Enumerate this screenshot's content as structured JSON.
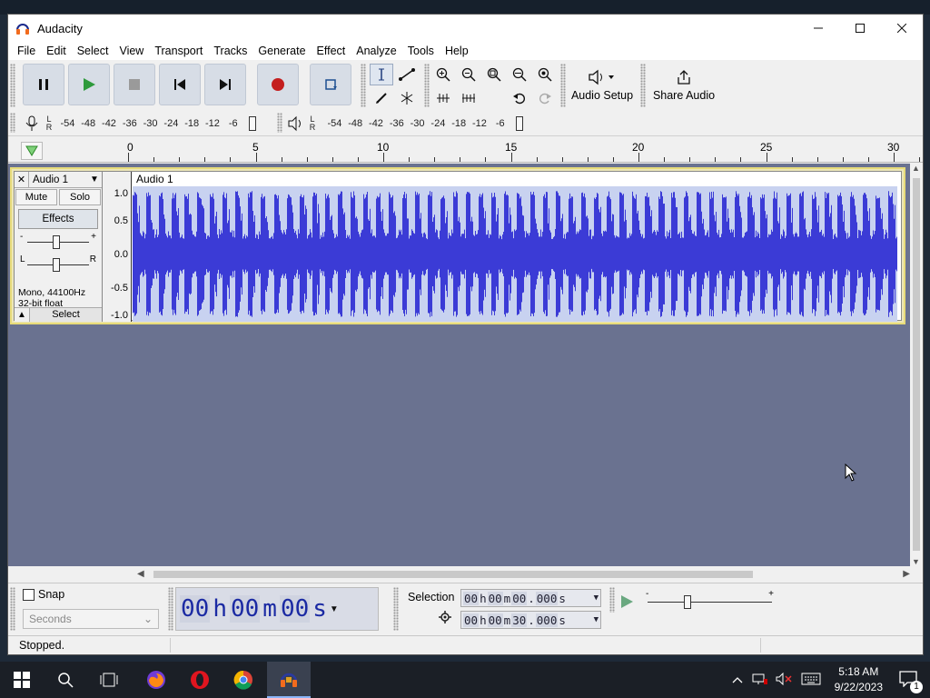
{
  "window": {
    "title": "Audacity",
    "controls": {
      "minimize": "—",
      "maximize": "☐",
      "close": "✕"
    }
  },
  "menu": [
    "File",
    "Edit",
    "Select",
    "View",
    "Transport",
    "Tracks",
    "Generate",
    "Effect",
    "Analyze",
    "Tools",
    "Help"
  ],
  "toolbar": {
    "audio_setup_label": "Audio Setup",
    "share_audio_label": "Share Audio",
    "recording_meter_scale": [
      "-54",
      "-48",
      "-42",
      "-36",
      "-30",
      "-24",
      "-18",
      "-12",
      "-6"
    ],
    "playback_meter_scale": [
      "-54",
      "-48",
      "-42",
      "-36",
      "-30",
      "-24",
      "-18",
      "-12",
      "-6"
    ],
    "lr_top": "L",
    "lr_bottom": "R"
  },
  "ruler": {
    "labels": [
      "0",
      "5",
      "10",
      "15",
      "20",
      "25",
      "30"
    ]
  },
  "track": {
    "name": "Audio 1",
    "close_label": "✕",
    "mute_label": "Mute",
    "solo_label": "Solo",
    "effects_label": "Effects",
    "gain_minus": "-",
    "gain_plus": "+",
    "pan_left": "L",
    "pan_right": "R",
    "format_line1": "Mono, 44100Hz",
    "format_line2": "32-bit float",
    "select_label": "Select",
    "clip_name": "Audio 1",
    "amp_labels": [
      "1.0",
      "0.5",
      "0.0",
      "-0.5",
      "-1.0"
    ],
    "wave_color": "#3b3bd6",
    "wave_bg": "#c8d2f0"
  },
  "selection_toolbar": {
    "snap_label": "Snap",
    "snap_checked": false,
    "snap_unit": "Seconds",
    "time_display": {
      "hh": "00",
      "h": "h",
      "mm": "00",
      "m": "m",
      "ss": "00",
      "s": "s"
    },
    "selection_label": "Selection",
    "start": {
      "hh": "00",
      "mm": "00",
      "ss": "00",
      "ms": "000"
    },
    "end": {
      "hh": "00",
      "mm": "00",
      "ss": "30",
      "ms": "000"
    },
    "speed_minus": "-",
    "speed_plus": "+"
  },
  "status": {
    "text": "Stopped."
  },
  "taskbar": {
    "time": "5:18 AM",
    "date": "9/22/2023",
    "notification_count": "1"
  }
}
